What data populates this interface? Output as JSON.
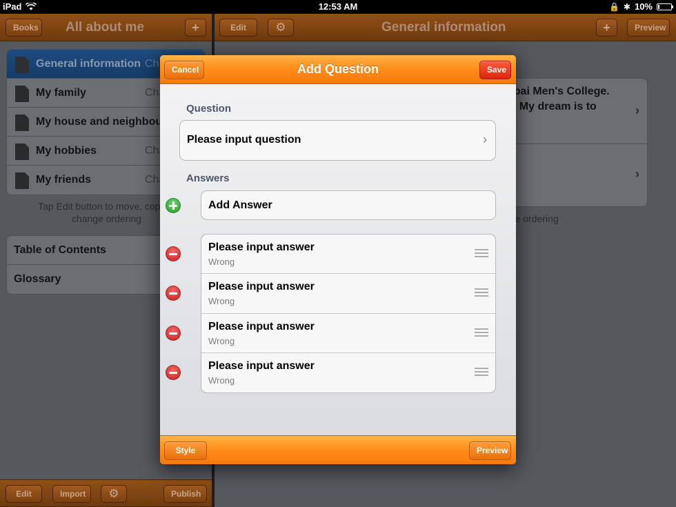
{
  "status": {
    "device": "iPad",
    "time": "12:53 AM",
    "battery": "10%",
    "battery_level": 0.1
  },
  "left": {
    "books_label": "Books",
    "title": "All about me",
    "add_label": "+",
    "chapters": [
      {
        "name": "General information",
        "tag": "Ch"
      },
      {
        "name": "My family",
        "tag": "Cha"
      },
      {
        "name": "My house and neighbou",
        "tag": ""
      },
      {
        "name": "My hobbies",
        "tag": "Cha"
      },
      {
        "name": "My friends",
        "tag": "Cha"
      }
    ],
    "hint_line1": "Tap Edit button to move, copy, d",
    "hint_line2": "change ordering",
    "extras": [
      "Table of Contents",
      "Glossary"
    ],
    "bottom": {
      "edit": "Edit",
      "import": "Import",
      "publish": "Publish"
    }
  },
  "right": {
    "edit_label": "Edit",
    "title": "General information",
    "add_label": "+",
    "preview_label": "Preview",
    "content_line1": "ubai Men's College.",
    "content_line2": "s. My dream is to",
    "hint": "nge ordering"
  },
  "modal": {
    "title": "Add Question",
    "cancel_label": "Cancel",
    "save_label": "Save",
    "question_header": "Question",
    "question_placeholder": "Please input question",
    "answers_header": "Answers",
    "add_answer_label": "Add Answer",
    "answers": [
      {
        "text": "Please input answer",
        "status": "Wrong"
      },
      {
        "text": "Please input answer",
        "status": "Wrong"
      },
      {
        "text": "Please input answer",
        "status": "Wrong"
      },
      {
        "text": "Please input answer",
        "status": "Wrong"
      }
    ],
    "style_label": "Style",
    "preview_label": "Preview"
  },
  "colors": {
    "accent_orange": "#ff8c1a",
    "save_red": "#d8280c",
    "add_green": "#1f9b1f",
    "delete_red": "#c41d1d"
  }
}
